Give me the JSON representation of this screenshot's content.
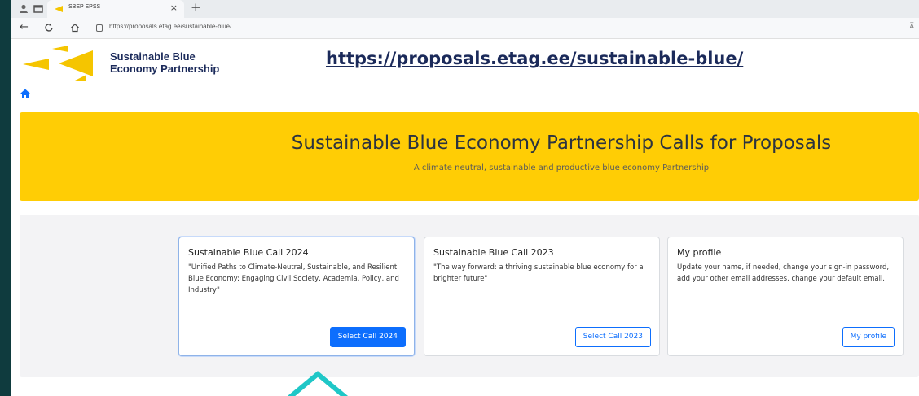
{
  "browser": {
    "tab_title": "SBEP EPSS",
    "tab_close": "×",
    "new_tab": "+",
    "address": "https://proposals.etag.ee/sustainable-blue/",
    "reader_mode": "A̅"
  },
  "site": {
    "logo_line1": "Sustainable Blue",
    "logo_line2": "Economy Partnership",
    "url_overlay": "https://proposals.etag.ee/sustainable-blue/"
  },
  "banner": {
    "title": "Sustainable Blue Economy Partnership Calls for Proposals",
    "subtitle": "A climate neutral, sustainable and productive blue economy Partnership"
  },
  "cards": [
    {
      "title": "Sustainable Blue Call 2024",
      "text": "\"Unified Paths to Climate-Neutral, Sustainable, and Resilient Blue Economy: Engaging Civil Society, Academia, Policy, and Industry\"",
      "button": "Select Call 2024"
    },
    {
      "title": "Sustainable Blue Call 2023",
      "text": "\"The way forward: a thriving sustainable blue economy for a brighter future\"",
      "button": "Select Call 2023"
    },
    {
      "title": "My profile",
      "text": "Update your name, if needed, change your sign-in password, add your other email addresses, change your default email.",
      "button": "My profile"
    }
  ],
  "colors": {
    "banner": "#ffcd05",
    "primary": "#0d6efd",
    "logo_yellow": "#f5c500",
    "logo_navy": "#1b2a5a",
    "outer_bg": "#0f3b3e",
    "annotation": "#1fc7c7"
  },
  "icons": {
    "home": "home-icon",
    "back": "back-arrow-icon",
    "refresh": "refresh-icon",
    "browser_home": "browser-home-icon",
    "lock": "lock-icon"
  }
}
